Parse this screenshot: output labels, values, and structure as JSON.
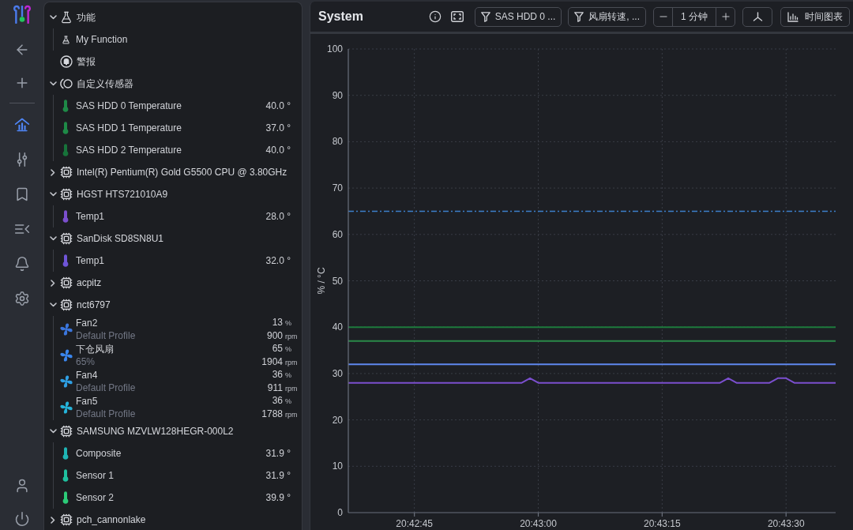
{
  "nav_rail": {
    "items": [
      {
        "kind": "dashboard",
        "selected": true
      },
      {
        "kind": "tuning",
        "selected": false
      },
      {
        "kind": "bookmarks",
        "selected": false
      },
      {
        "kind": "queue",
        "selected": false
      },
      {
        "kind": "alerts",
        "selected": false
      },
      {
        "kind": "settings",
        "selected": false
      }
    ]
  },
  "tree": [
    {
      "kind": "functions",
      "label": "功能",
      "expanded": true,
      "children": [
        {
          "kind": "function",
          "label": "My Function"
        }
      ]
    },
    {
      "kind": "alerts",
      "label": "警报"
    },
    {
      "kind": "custom",
      "label": "自定义传感器",
      "expanded": true,
      "children": [
        {
          "kind": "temperature",
          "label": "SAS HDD 0 Temperature",
          "value": "40.0 °",
          "color": "#1e8a47"
        },
        {
          "kind": "temperature",
          "label": "SAS HDD 1 Temperature",
          "value": "37.0 °",
          "color": "#1e8a47"
        },
        {
          "kind": "temperature",
          "label": "SAS HDD 2 Temperature",
          "value": "40.0 °",
          "color": "#17733a"
        }
      ]
    },
    {
      "kind": "device",
      "label": "Intel(R) Pentium(R) Gold G5500 CPU @ 3.80GHz",
      "expanded": false
    },
    {
      "kind": "device",
      "label": "HGST HTS721010A9",
      "expanded": true,
      "children": [
        {
          "kind": "temperature",
          "label": "Temp1",
          "value": "28.0 °",
          "color": "#7b4fce"
        }
      ]
    },
    {
      "kind": "device",
      "label": "SanDisk SD8SN8U1",
      "expanded": true,
      "children": [
        {
          "kind": "temperature",
          "label": "Temp1",
          "value": "32.0 °",
          "color": "#6f55d8"
        }
      ]
    },
    {
      "kind": "device",
      "label": "acpitz",
      "expanded": false
    },
    {
      "kind": "device",
      "label": "nct6797",
      "expanded": true,
      "children": [
        {
          "kind": "fan",
          "label": "Fan2",
          "detail": "Default Profile",
          "speed": "13",
          "speed_unit": "%",
          "rpm": "900",
          "rpm_unit": "rpm",
          "color": "#3b76dd"
        },
        {
          "kind": "fan",
          "label": "下仓风扇",
          "detail": "65%",
          "speed": "65",
          "speed_unit": "%",
          "rpm": "1904",
          "rpm_unit": "rpm",
          "color": "#3a86ee"
        },
        {
          "kind": "fan",
          "label": "Fan4",
          "detail": "Default Profile",
          "speed": "36",
          "speed_unit": "%",
          "rpm": "911",
          "rpm_unit": "rpm",
          "color": "#2f9fe3"
        },
        {
          "kind": "fan",
          "label": "Fan5",
          "detail": "Default Profile",
          "speed": "36",
          "speed_unit": "%",
          "rpm": "1788",
          "rpm_unit": "rpm",
          "color": "#25b3d9"
        }
      ]
    },
    {
      "kind": "device",
      "label": "SAMSUNG MZVLW128HEGR-000L2",
      "expanded": true,
      "children": [
        {
          "kind": "temperature",
          "label": "Composite",
          "value": "31.9 °",
          "color": "#1fb5b5"
        },
        {
          "kind": "temperature",
          "label": "Sensor 1",
          "value": "31.9 °",
          "color": "#1fc19f"
        },
        {
          "kind": "temperature",
          "label": "Sensor 2",
          "value": "39.9 °",
          "color": "#2ccb78"
        }
      ]
    },
    {
      "kind": "device",
      "label": "pch_cannonlake",
      "expanded": false
    }
  ],
  "chart_panel": {
    "title": "System",
    "filters": [
      {
        "label": "SAS HDD 0 ..."
      },
      {
        "label": "风扇转速, ..."
      }
    ],
    "time_range": "1 分钟",
    "view_button": "时间图表",
    "chart_data": [
      {
        "type": "line",
        "ylabel": "% / °C",
        "xlim": [
          20.710278,
          20.726667
        ],
        "xticks": [
          {
            "value": 20.7125,
            "label": "20:42:45"
          },
          {
            "value": 20.716667,
            "label": "20:43:00"
          },
          {
            "value": 20.720833,
            "label": "20:43:15"
          },
          {
            "value": 20.725,
            "label": "20:43:30"
          }
        ],
        "ylim": [
          0,
          100
        ],
        "yticks": [
          0,
          10,
          20,
          30,
          40,
          50,
          60,
          70,
          80,
          90,
          100
        ],
        "grid": true,
        "ref_lines": [
          {
            "axis": "y",
            "value": 65,
            "color": "#3d7fca",
            "line_style": "dashdot"
          }
        ],
        "series": [
          {
            "color": "#1d7a3c",
            "x": [
              20.710278,
              20.726667
            ],
            "values": [
              40,
              40
            ]
          },
          {
            "color": "#2a8a48",
            "x": [
              20.710278,
              20.726667
            ],
            "values": [
              37,
              37
            ]
          },
          {
            "color": "#5f88ee",
            "x": [
              20.710278,
              20.726667
            ],
            "values": [
              32,
              32
            ]
          },
          {
            "color": "#7b4fce",
            "x": [
              20.710278,
              20.716111,
              20.716389,
              20.716667,
              20.722778,
              20.723056,
              20.723333,
              20.724444,
              20.724722,
              20.725,
              20.725278,
              20.726667
            ],
            "values": [
              28,
              28,
              29,
              28,
              28,
              29,
              28,
              28,
              29,
              29,
              28,
              28
            ]
          }
        ]
      }
    ]
  }
}
